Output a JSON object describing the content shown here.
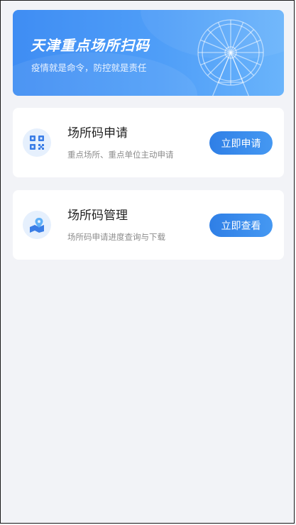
{
  "banner": {
    "title": "天津重点场所扫码",
    "subtitle": "疫情就是命令，防控就是责任"
  },
  "cards": [
    {
      "title": "场所码申请",
      "description": "重点场所、重点单位主动申请",
      "button_label": "立即申请",
      "icon": "qr-code-icon"
    },
    {
      "title": "场所码管理",
      "description": "场所码申请进度查询与下载",
      "button_label": "立即查看",
      "icon": "map-location-icon"
    }
  ],
  "colors": {
    "background": "#f2f3f7",
    "banner_start": "#3f8df3",
    "banner_end": "#6ab4fb",
    "accent": "#2f7fe6",
    "icon_bg": "#e6f0fd"
  }
}
